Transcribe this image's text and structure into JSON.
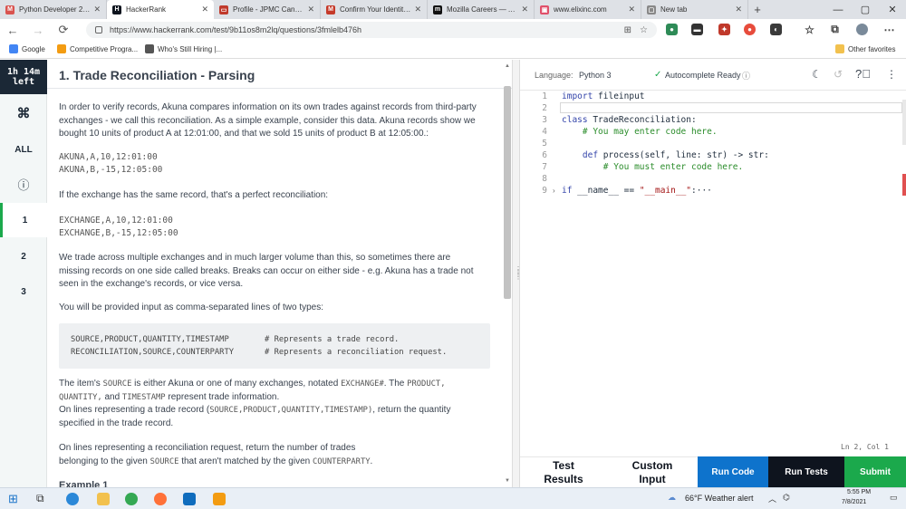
{
  "browser": {
    "tabs": [
      {
        "title": "Python Developer 20…",
        "fav_color": "#d9534f",
        "fav_glyph": "M"
      },
      {
        "title": "HackerRank",
        "fav_color": "#1ba94c",
        "fav_glyph": "H",
        "active": true
      },
      {
        "title": "Profile - JPMC Candid…",
        "fav_color": "#c0392b",
        "fav_glyph": "▭"
      },
      {
        "title": "Confirm Your Identity…",
        "fav_color": "#c53929",
        "fav_glyph": "M"
      },
      {
        "title": "Mozilla Careers — All…",
        "fav_color": "#111111",
        "fav_glyph": "m"
      },
      {
        "title": "www.elixinc.com",
        "fav_color": "#e0506a",
        "fav_glyph": "▣"
      },
      {
        "title": "New tab",
        "fav_color": "#888888",
        "fav_glyph": "▢"
      }
    ],
    "url": "https://www.hackerrank.com/test/9b11os8m2lq/questions/3fmlelb476h",
    "bookmarks": [
      "Google",
      "Competitive Progra...",
      "Who's Still Hiring |..."
    ],
    "other_favorites": "Other favorites"
  },
  "rail": {
    "timer": "1h 14m\nleft",
    "items": [
      "⌘",
      "ALL",
      "ⓘ",
      "1",
      "2",
      "3"
    ]
  },
  "problem": {
    "title": "1. Trade Reconciliation - Parsing",
    "p1": "In order to verify records, Akuna compares information on its own trades against records from third-party exchanges - we call this reconciliation. As a simple example, consider this data. Akuna records show we bought 10 units of product A at 12:01:00, and that we sold 15 units of product B at 12:05:00.:",
    "akuna_lines": [
      "AKUNA,A,10,12:01:00",
      "AKUNA,B,-15,12:05:00"
    ],
    "p2": "If the exchange has the same record, that's a perfect reconciliation:",
    "exchange_lines": [
      "EXCHANGE,A,10,12:01:00",
      "EXCHANGE,B,-15,12:05:00"
    ],
    "p3": "We trade across multiple exchanges and in much larger volume than this, so sometimes there are missing records on one side called breaks. Breaks can occur on either side - e.g. Akuna has a trade not seen in the exchange's records, or vice versa.",
    "p4": "You will be provided input as comma-separated lines of two types:",
    "types": [
      {
        "fmt": "SOURCE,PRODUCT,QUANTITY,TIMESTAMP",
        "comment": "# Represents a trade record."
      },
      {
        "fmt": "RECONCILIATION,SOURCE,COUNTERPARTY",
        "comment": "# Represents a reconciliation request."
      }
    ],
    "p5_a": "The item's",
    "p5_source": "SOURCE",
    "p5_b": "is either Akuna or one of many exchanges, notated",
    "p5_exchange": "EXCHANGE#",
    "p5_c": ". The",
    "p5_product": "PRODUCT,",
    "p5_quantity": "QUANTITY,",
    "p5_and": "and",
    "p5_timestamp": "TIMESTAMP",
    "p5_d": "represent trade information.",
    "p6_a": "On lines representing a trade record (",
    "p6_code": "SOURCE,PRODUCT,QUANTITY,TIMESTAMP)",
    "p6_b": ", return the quantity specified in the trade record.",
    "p7_a": "On lines representing a reconciliation request, return the number of trades belonging to the given",
    "p7_source": "SOURCE",
    "p7_b": "that aren't matched by the given",
    "p7_counter": "COUNTERPARTY",
    "p7_c": ".",
    "example_heading": "Example 1"
  },
  "editor": {
    "language_label": "Language:",
    "language": "Python 3",
    "autocomplete": "Autocomplete Ready",
    "lines": [
      {
        "n": "1",
        "html": [
          [
            "kw",
            "import"
          ],
          [
            "",
            " fileinput"
          ]
        ]
      },
      {
        "n": "2",
        "html": []
      },
      {
        "n": "3",
        "html": [
          [
            "kw",
            "class"
          ],
          [
            "",
            " TradeReconciliation:"
          ]
        ]
      },
      {
        "n": "4",
        "html": [
          [
            "cm",
            "    # You may enter code here."
          ]
        ]
      },
      {
        "n": "5",
        "html": []
      },
      {
        "n": "6",
        "html": [
          [
            "kw",
            "    def"
          ],
          [
            "",
            " process(self, line: str) -> str:"
          ]
        ]
      },
      {
        "n": "7",
        "html": [
          [
            "cm",
            "        # You must enter code here."
          ]
        ]
      },
      {
        "n": "8",
        "html": []
      },
      {
        "n": "9",
        "html": [
          [
            "kw",
            "if"
          ],
          [
            "",
            " __name__ == "
          ],
          [
            "st",
            "\"__main__\""
          ],
          [
            "",
            ":···"
          ]
        ]
      }
    ],
    "status": "Ln 2, Col 1"
  },
  "footer": {
    "test_results": "Test\nResults",
    "custom_input": "Custom\nInput",
    "run_code": "Run Code",
    "run_tests": "Run Tests",
    "submit": "Submit"
  },
  "taskbar": {
    "weather": "66°F  Weather alert",
    "time": "5:55 PM",
    "date": "7/8/2021"
  },
  "colors": {
    "accent_blue": "#0e73cc",
    "accent_green": "#1ba94c",
    "dark": "#0e141e"
  }
}
